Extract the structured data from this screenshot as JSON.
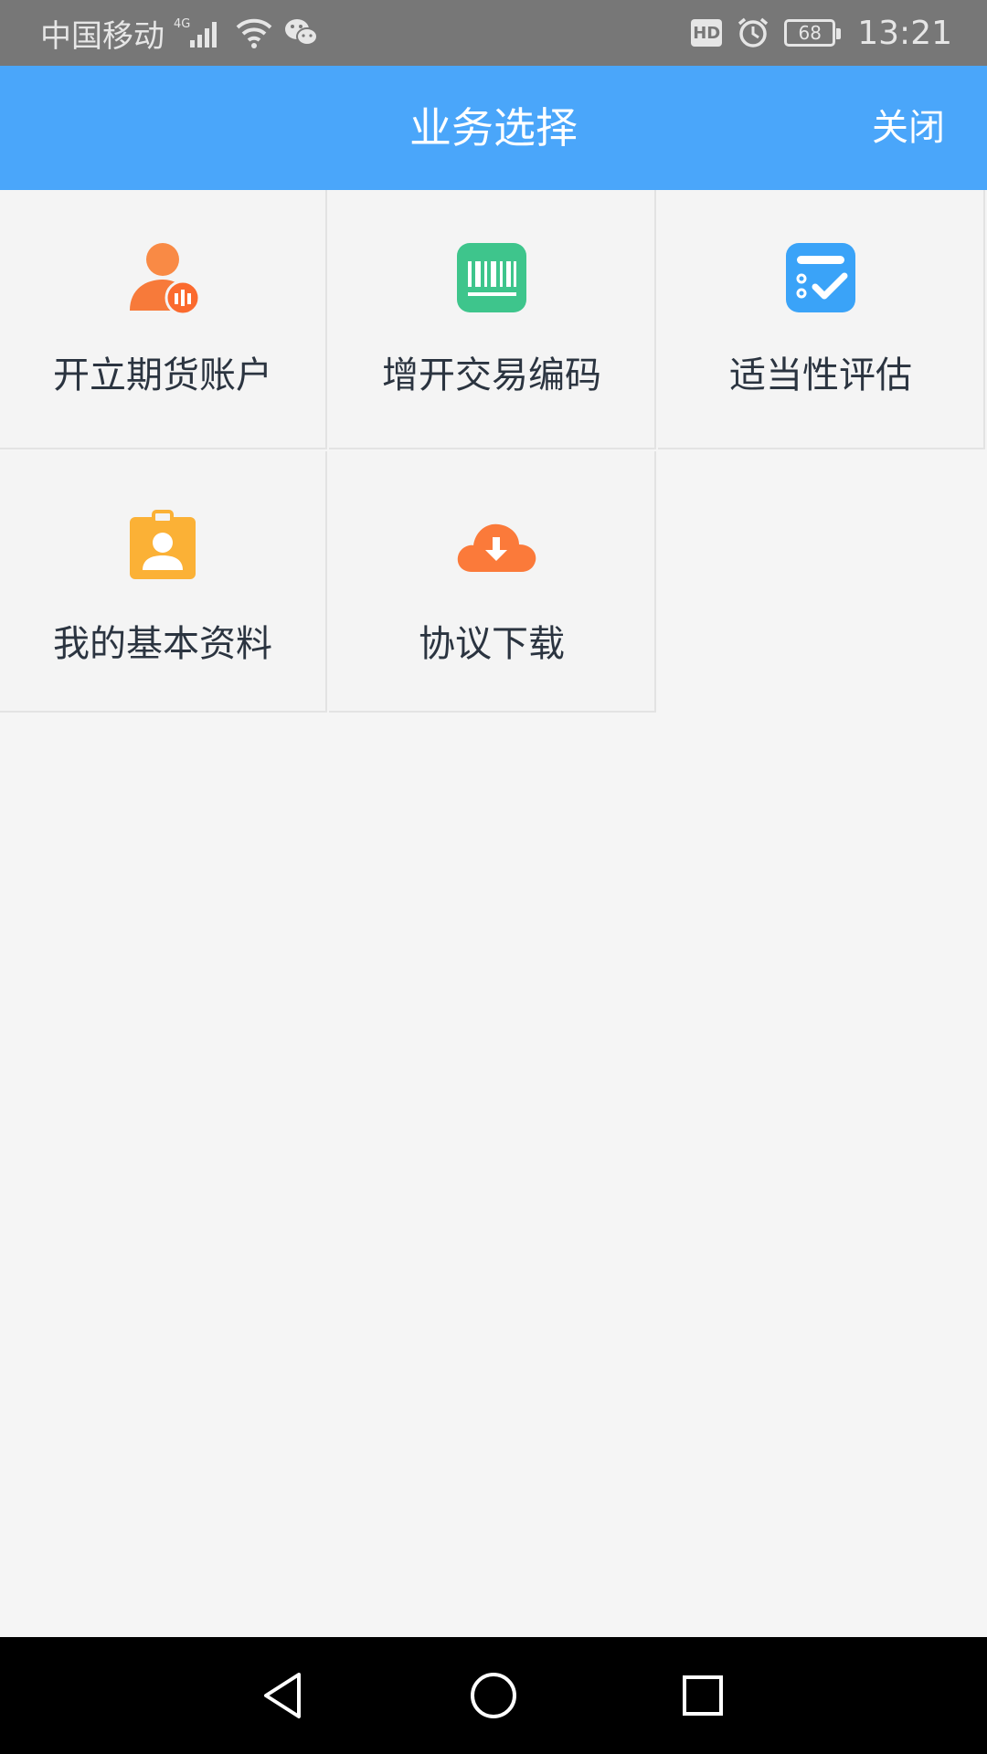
{
  "status_bar": {
    "carrier": "中国移动",
    "network": "4G",
    "time": "13:21",
    "battery": "68",
    "hd": "HD",
    "icons": [
      "signal-icon",
      "wifi-icon",
      "wechat-icon",
      "hd-icon",
      "alarm-icon",
      "battery-icon"
    ]
  },
  "header": {
    "title": "业务选择",
    "close_label": "关闭",
    "background": "#4aa6fa"
  },
  "grid": {
    "items": [
      {
        "label": "开立期货账户",
        "icon": "open-account-icon",
        "color": "#f77a3a"
      },
      {
        "label": "增开交易编码",
        "icon": "barcode-icon",
        "color": "#3ec58c"
      },
      {
        "label": "适当性评估",
        "icon": "assessment-icon",
        "color": "#3aa3f8"
      },
      {
        "label": "我的基本资料",
        "icon": "profile-card-icon",
        "color": "#fbb136"
      },
      {
        "label": "协议下载",
        "icon": "cloud-download-icon",
        "color": "#fb7a3a"
      }
    ]
  },
  "nav_bar": {
    "icons": [
      "back-icon",
      "home-icon",
      "recents-icon"
    ]
  }
}
